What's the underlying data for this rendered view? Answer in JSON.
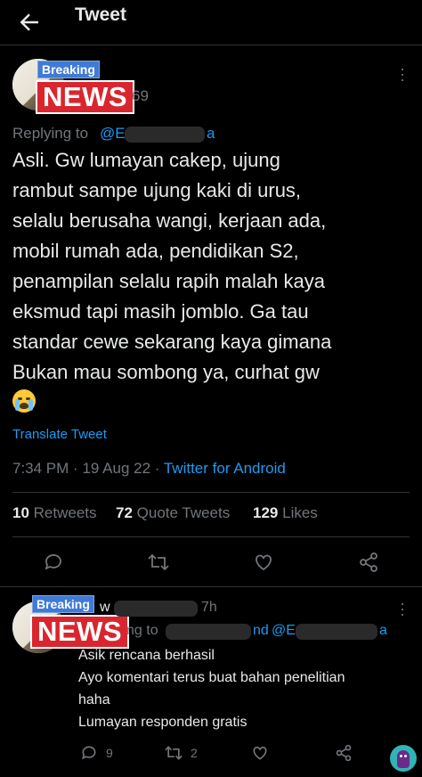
{
  "header": {
    "title": "Tweet"
  },
  "tweet": {
    "author_badge_top": "Breaking",
    "author_badge_main": "NEWS",
    "handle_visible": "69",
    "replying_prefix": "Replying to",
    "replying_handle_start": "@E",
    "replying_handle_end": "a",
    "text_lines": [
      "Asli. Gw lumayan cakep, ujung",
      "rambut sampe ujung kaki di urus,",
      "selalu berusaha wangi, kerjaan ada,",
      "mobil rumah ada, pendidikan S2,",
      "penampilan selalu rapih malah kaya",
      "eksmud tapi masih jomblo. Ga tau",
      "standar cewe sekarang kaya gimana",
      "Bukan mau sombong ya, curhat gw"
    ],
    "emoji": "loudly-crying-face",
    "translate_label": "Translate Tweet",
    "time": "7:34 PM",
    "date": "19 Aug 22",
    "separator": "·",
    "source": "Twitter for Android",
    "retweets_count": "10",
    "retweets_label": "Retweets",
    "quotes_count": "72",
    "quotes_label": "Quote Tweets",
    "likes_count": "129",
    "likes_label": "Likes"
  },
  "reply": {
    "author_badge_top": "Breaking",
    "author_badge_main": "NEWS",
    "name_visible": "w",
    "time_visible": "7h",
    "replying_suffix_visible": "ng to",
    "mention_end": "nd",
    "second_handle_start": "@E",
    "second_handle_end": "a",
    "lines": [
      "Asik rencana berhasil",
      "Ayo komentari terus buat bahan penelitian",
      "haha",
      "Lumayan responden gratis"
    ],
    "reply_count": "9",
    "retweet_count": "2"
  },
  "colors": {
    "accent": "#1d9bf0",
    "muted": "#71767b",
    "text": "#e7e9ea",
    "bg": "#000000"
  },
  "icons": [
    "back-arrow-icon",
    "more-icon",
    "reply-icon",
    "retweet-icon",
    "like-icon",
    "share-icon"
  ]
}
